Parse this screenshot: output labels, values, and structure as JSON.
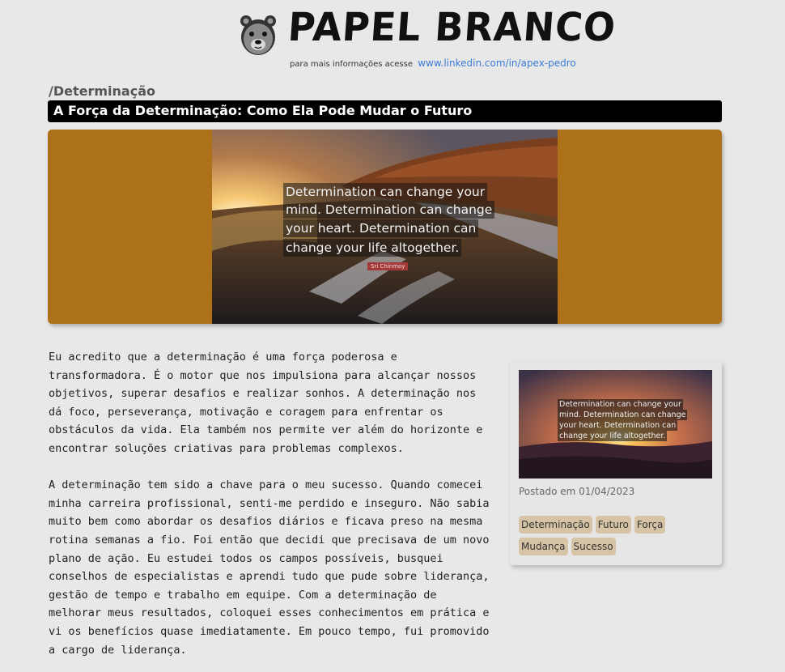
{
  "header": {
    "brand": "PAPEL BRANCO",
    "info_text": "para mais informações acesse",
    "info_link": "www.linkedin.com/in/apex-pedro"
  },
  "post": {
    "category": "/Determinação",
    "title": "A Força da Determinação: Como Ela Pode Mudar o Futuro",
    "hero_quote": [
      "Determination can change your",
      "mind. Determination can change",
      "your heart. Determination can",
      "change your life altogether."
    ],
    "hero_author": "Sri Chinmoy",
    "paragraphs": [
      "Eu acredito que a determinação é uma força poderosa e transformadora. É o motor que nos impulsiona para alcançar nossos objetivos, superar desafios e realizar sonhos. A determinação nos dá foco, perseverança, motivação e coragem para enfrentar os obstáculos da vida. Ela também nos permite ver além do horizonte e encontrar soluções criativas para problemas complexos.",
      "A determinação tem sido a chave para o meu sucesso. Quando comecei minha carreira profissional, senti-me perdido e inseguro. Não sabia muito bem como abordar os desafios diários e ficava preso na mesma rotina semanas a fio. Foi então que decidi que precisava de um novo plano de ação. Eu estudei todos os campos possíveis, busquei conselhos de especialistas e aprendi tudo que pude sobre liderança, gestão de tempo e trabalho em equipe. Com a determinação de melhorar meus resultados, coloquei esses conhecimentos em prática e vi os benefícios quase imediatamente. Em pouco tempo, fui promovido a cargo de liderança."
    ]
  },
  "sidebar": {
    "thumb_quote": [
      "Determination can change your",
      "mind. Determination can change",
      "your heart. Determination can",
      "change your life altogether."
    ],
    "posted": "Postado em 01/04/2023",
    "tags": [
      "Determinação",
      "Futuro",
      "Força",
      "Mudança",
      "Sucesso"
    ]
  },
  "colors": {
    "hero_bg": "#ad7119",
    "tag_bg": "#d7c3a5",
    "link": "#3a7bd5"
  }
}
